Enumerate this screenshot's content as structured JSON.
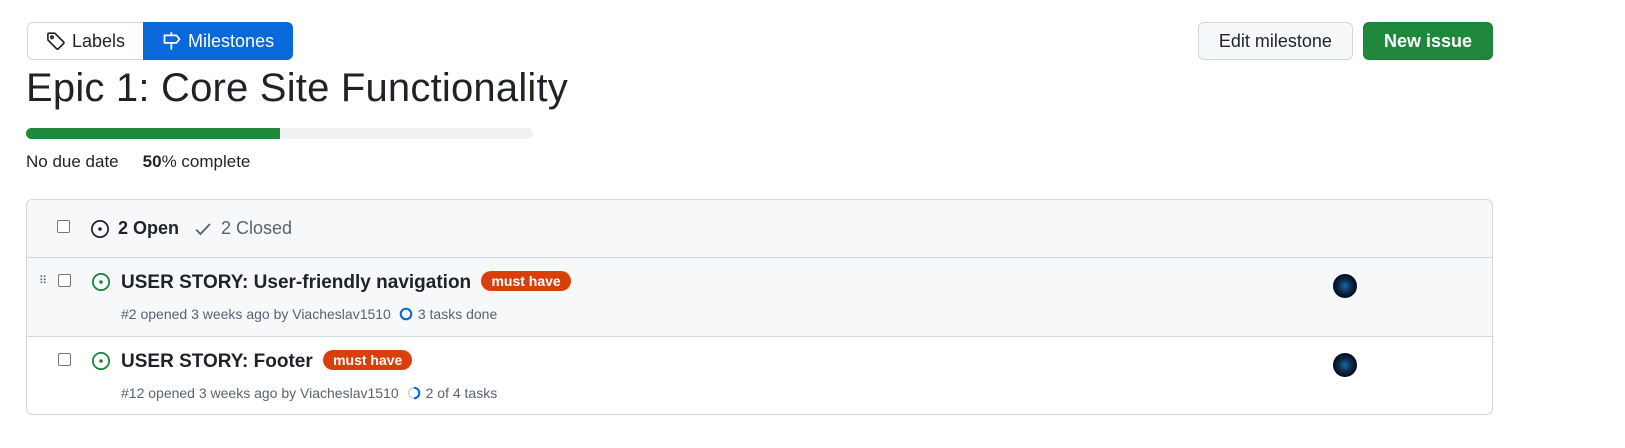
{
  "nav": {
    "labels": "Labels",
    "milestones": "Milestones"
  },
  "actions": {
    "edit": "Edit milestone",
    "new": "New issue"
  },
  "milestone": {
    "title": "Epic 1: Core Site Functionality",
    "progress_fraction": 0.5,
    "due": "No due date",
    "percent": "50",
    "complete_label": "% complete"
  },
  "issues_header": {
    "open": "2 Open",
    "closed": "2 Closed"
  },
  "issues": [
    {
      "title": "USER STORY: User-friendly navigation",
      "label": "must have",
      "meta": "#2 opened 3 weeks ago by Viacheslav1510",
      "tasks": "3 tasks done"
    },
    {
      "title": "USER STORY: Footer",
      "label": "must have",
      "meta": "#12 opened 3 weeks ago by Viacheslav1510",
      "tasks": "2 of 4 tasks"
    }
  ],
  "colors": {
    "accent": "#0969da",
    "success": "#1f883d",
    "label_must_have": "#d93f0b"
  }
}
